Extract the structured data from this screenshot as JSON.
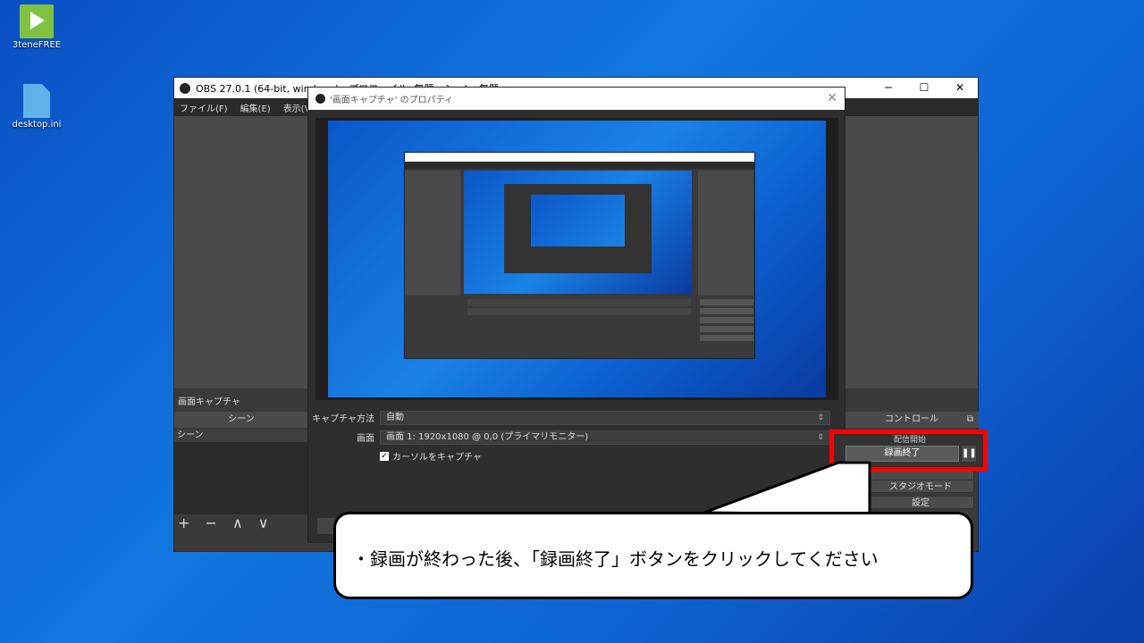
{
  "desktop": {
    "icons": [
      {
        "label": "3teneFREE"
      },
      {
        "label": "desktop.ini"
      }
    ]
  },
  "obs": {
    "title": "OBS 27.0.1 (64-bit, windows) - プロファイル: 無題 - シーン: 無題",
    "menu": [
      "ファイル(F)",
      "編集(E)",
      "表示(V)"
    ],
    "source_label": "画面キャプチャ",
    "scene_header": "シーン",
    "scene_item": "シーン",
    "scene_tools": "+ − ∧ ∨",
    "controls_header": "コントロール",
    "controls": {
      "stream": "配信開始",
      "stop_recording": "録画終了",
      "pause": "❚❚",
      "studio_mode": "スタジオモード",
      "settings": "設定"
    }
  },
  "dialog": {
    "title": "'画面キャプチャ' のプロパティ",
    "close": "✕",
    "capture_method_label": "キャプチャ方法",
    "capture_method_value": "自動",
    "screen_label": "画面",
    "screen_value": "画面 1: 1920x1080 @ 0,0 (プライマリモニター)",
    "cursor_label": "カーソルをキャプチャ",
    "cursor_checked": "✓"
  },
  "callout": {
    "text": "・録画が終わった後、「録画終了」ボタンをクリックしてください"
  },
  "colors": {
    "highlight": "#ff0000",
    "desktop_blue": "#1177e0"
  }
}
